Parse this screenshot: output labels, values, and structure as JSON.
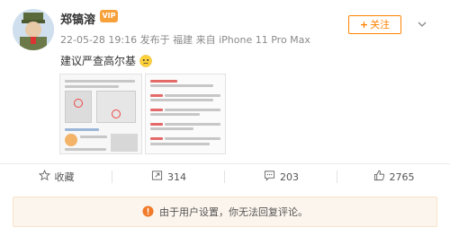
{
  "post": {
    "username": "郑镐溶",
    "vip_badge": "VIP",
    "meta_line": "22-05-28 19:16 发布于 福建 来自 iPhone 11 Pro Max",
    "text": "建议严查高尔基",
    "follow_label": "关注"
  },
  "actions": {
    "favorite_label": "收藏",
    "repost_count": "314",
    "comment_count": "203",
    "like_count": "2765"
  },
  "notice": {
    "text": "由于用户设置，你无法回复评论。"
  },
  "colors": {
    "accent": "#ff8200",
    "notice_bg": "#fcf5ed",
    "notice_icon": "#f07a2a"
  }
}
